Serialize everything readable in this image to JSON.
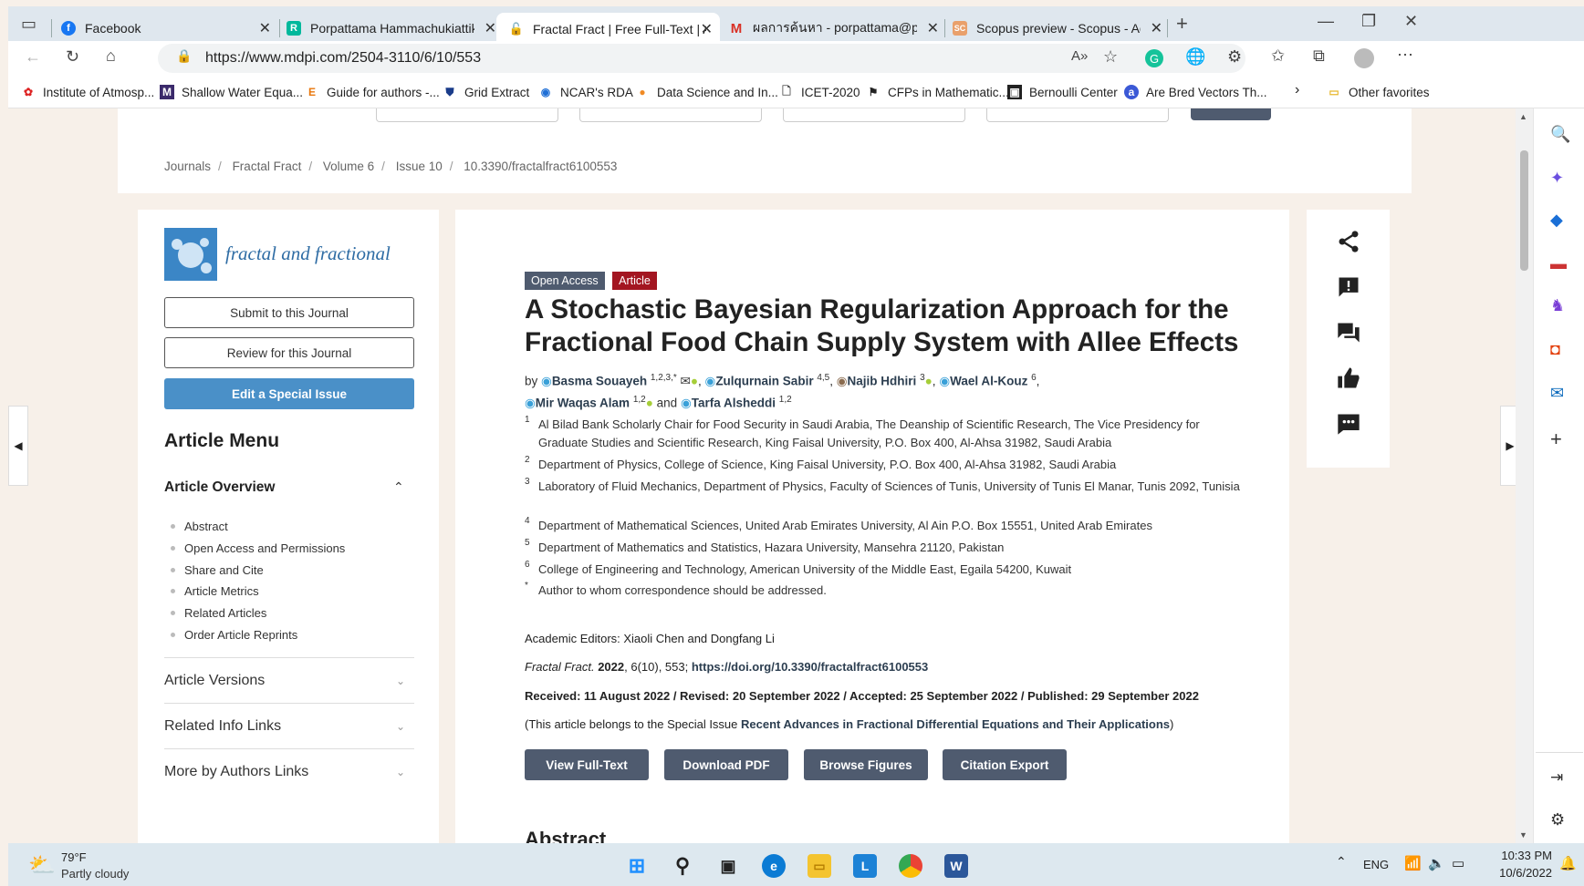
{
  "tabs": [
    {
      "title": "Facebook",
      "icon": "facebook-icon"
    },
    {
      "title": "Porpattama Hammachukiattikul |",
      "icon": "researchgate-icon"
    },
    {
      "title": "Fractal Fract | Free Full-Text | A S",
      "icon": "lock-icon"
    },
    {
      "title": "ผลการค้นหา - porpattama@pkru.",
      "icon": "gmail-icon"
    },
    {
      "title": "Scopus preview - Scopus - Advan",
      "icon": "scopus-icon"
    }
  ],
  "url": "https://www.mdpi.com/2504-3110/6/10/553",
  "bookmarks": [
    "Institute of Atmosp...",
    "Shallow Water Equa...",
    "Guide for authors -...",
    "Grid Extract",
    "NCAR's RDA",
    "Data Science and In...",
    "ICET-2020",
    "CFPs in Mathematic...",
    "Bernoulli Center",
    "Are Bred Vectors Th..."
  ],
  "other_favorites": "Other favorites",
  "breadcrumb": [
    "Journals",
    "Fractal Fract",
    "Volume 6",
    "Issue 10",
    "10.3390/fractalfract6100553"
  ],
  "journal_name": "fractal and fractional",
  "sidebar": {
    "submit": "Submit to this Journal",
    "review": "Review for this Journal",
    "edit": "Edit a Special Issue",
    "menu_title": "Article Menu",
    "overview": "Article Overview",
    "overview_items": [
      "Abstract",
      "Open Access and Permissions",
      "Share and Cite",
      "Article Metrics",
      "Related Articles",
      "Order Article Reprints"
    ],
    "versions": "Article Versions",
    "related": "Related Info Links",
    "more_authors": "More by Authors Links"
  },
  "article": {
    "tag_open": "Open Access",
    "tag_article": "Article",
    "title": "A Stochastic Bayesian Regularization Approach for the Fractional Food Chain Supply System with Allee Effects",
    "by": "by",
    "authors": [
      {
        "name": "Basma Souayeh",
        "sup": "1,2,3,*"
      },
      {
        "name": "Zulqurnain Sabir",
        "sup": "4,5"
      },
      {
        "name": "Najib Hdhiri",
        "sup": "3"
      },
      {
        "name": "Wael Al-Kouz",
        "sup": "6"
      },
      {
        "name": "Mir Waqas Alam",
        "sup": "1,2"
      },
      {
        "name": "Tarfa Alsheddi",
        "sup": "1,2"
      }
    ],
    "and": "and",
    "affiliations": [
      {
        "n": "1",
        "text": "Al Bilad Bank Scholarly Chair for Food Security in Saudi Arabia, The Deanship of Scientific Research, The Vice Presidency for Graduate Studies and Scientific Research, King Faisal University, P.O. Box 400, Al-Ahsa 31982, Saudi Arabia"
      },
      {
        "n": "2",
        "text": "Department of Physics, College of Science, King Faisal University, P.O. Box 400, Al-Ahsa 31982, Saudi Arabia"
      },
      {
        "n": "3",
        "text": "Laboratory of Fluid Mechanics, Department of Physics, Faculty of Sciences of Tunis, University of Tunis El Manar, Tunis 2092, Tunisia"
      },
      {
        "n": "4",
        "text": "Department of Mathematical Sciences, United Arab Emirates University, Al Ain P.O. Box 15551, United Arab Emirates"
      },
      {
        "n": "5",
        "text": "Department of Mathematics and Statistics, Hazara University, Mansehra 21120, Pakistan"
      },
      {
        "n": "6",
        "text": "College of Engineering and Technology, American University of the Middle East, Egaila 54200, Kuwait"
      },
      {
        "n": "*",
        "text": "Author to whom correspondence should be addressed."
      }
    ],
    "editors": "Academic Editors: Xiaoli Chen and Dongfang Li",
    "citation_journal": "Fractal Fract.",
    "citation_year": "2022",
    "citation_rest": ", 6(10), 553;",
    "doi": "https://doi.org/10.3390/fractalfract6100553",
    "dates": "Received: 11 August 2022 / Revised: 20 September 2022 / Accepted: 25 September 2022 / Published: 29 September 2022",
    "special_prefix": "(This article belongs to the Special Issue ",
    "special_issue": "Recent Advances in Fractional Differential Equations and Their Applications",
    "special_suffix": ")",
    "buttons": [
      "View Full-Text",
      "Download PDF",
      "Browse Figures",
      "Citation Export"
    ],
    "abstract_heading": "Abstract"
  },
  "weather": {
    "temp": "79°F",
    "desc": "Partly cloudy"
  },
  "taskbar": {
    "lang": "ENG",
    "time": "10:33 PM",
    "date": "10/6/2022"
  },
  "colors": {
    "tag_open": "#4f5b6f",
    "tag_article": "#a31621",
    "blue_button": "#4a90c8",
    "dark_button": "#4f5b6f"
  }
}
